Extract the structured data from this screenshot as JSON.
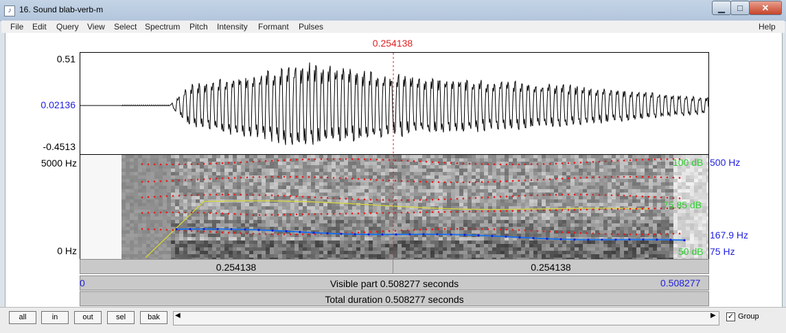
{
  "window": {
    "title": "16. Sound blab-verb-m",
    "icon": "praat-sound-icon",
    "controls": {
      "minimize": "▁",
      "maximize": "□",
      "close": "✕"
    }
  },
  "menu": {
    "items": [
      "File",
      "Edit",
      "Query",
      "View",
      "Select",
      "Spectrum",
      "Pitch",
      "Intensity",
      "Formant",
      "Pulses"
    ],
    "help": "Help"
  },
  "cursor": {
    "time_label": "0.254138",
    "time": 0.254138
  },
  "waveform": {
    "top_label": "0.51",
    "cursor_value": "0.02136",
    "bottom_label": "-0.4513"
  },
  "spectrogram": {
    "freq_top": "5000 Hz",
    "freq_bottom": "0 Hz",
    "intensity_top": "100 dB",
    "intensity_mid": "75.85 dB",
    "intensity_bottom": "50 dB",
    "pitch_top": "500 Hz",
    "pitch_value": "167.9 Hz",
    "pitch_bottom": "75 Hz"
  },
  "time_bars": {
    "left_part": "0.254138",
    "right_part": "0.254138",
    "visible_start": "0",
    "visible_label": "Visible part 0.508277 seconds",
    "visible_end": "0.508277",
    "total_label": "Total duration 0.508277 seconds"
  },
  "bottom_buttons": [
    "all",
    "in",
    "out",
    "sel",
    "bak"
  ],
  "group": {
    "label": "Group",
    "checked": "✓"
  },
  "colors": {
    "cursor": "#e02020",
    "waveform": "#000000",
    "formant": "#e51c1c",
    "intensity": "#d8d83a",
    "pitch": "#1a70e8",
    "pitch_points": "#1a1acc",
    "label_blue": "#1e1ee0",
    "label_green": "#2ecf2e"
  }
}
